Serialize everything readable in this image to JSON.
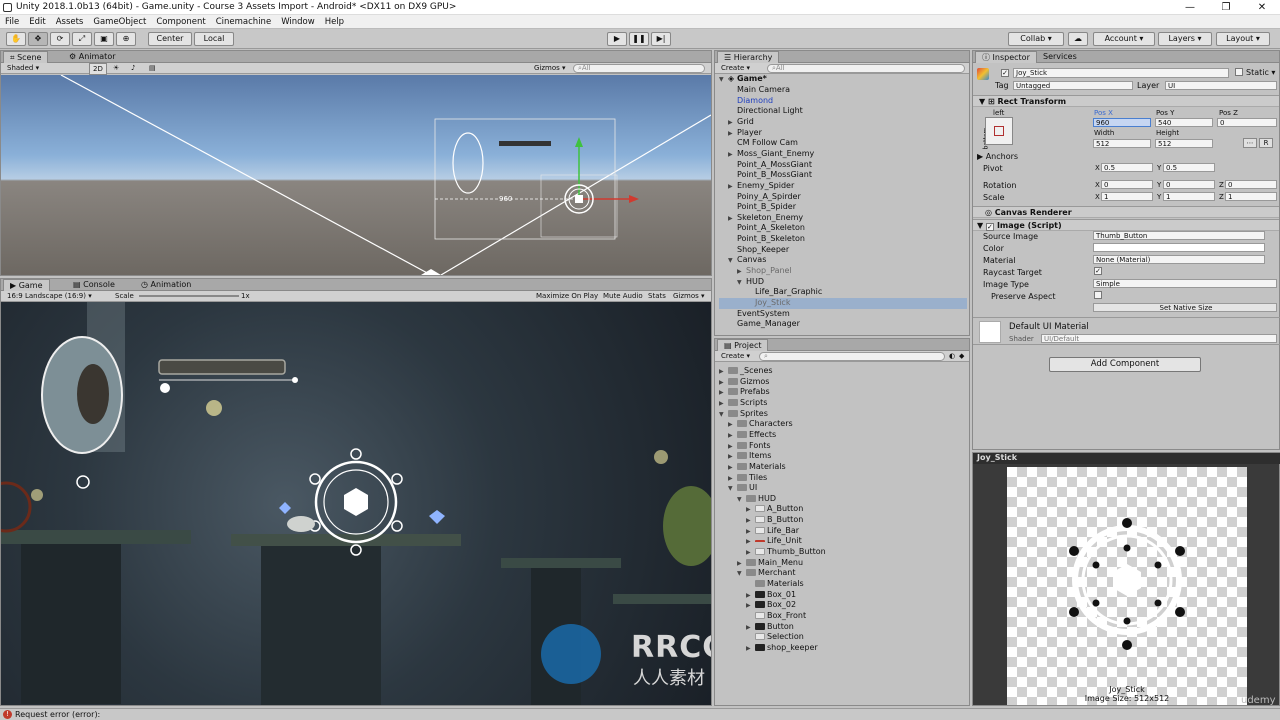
{
  "window": {
    "title": "Unity 2018.1.0b13 (64bit) - Game.unity - Course 3 Assets Import - Android* <DX11 on DX9 GPU>",
    "controls": [
      "—",
      "❐",
      "✕"
    ]
  },
  "menu": [
    "File",
    "Edit",
    "Assets",
    "GameObject",
    "Component",
    "Cinemachine",
    "Window",
    "Help"
  ],
  "toolbar": {
    "pivot": "Center",
    "space": "Local",
    "collab": "Collab",
    "account": "Account",
    "layers": "Layers",
    "layout": "Layout"
  },
  "scene": {
    "tabs": [
      "Scene",
      "Animator"
    ],
    "shading": "Shaded",
    "mode2d": "2D",
    "gizmos": "Gizmos",
    "search": "All",
    "pos_readout": "960"
  },
  "game": {
    "tabs": [
      "Game",
      "Console",
      "Animation"
    ],
    "aspect": "16:9 Landscape (16:9)",
    "scale_label": "Scale",
    "scale_value": "1x",
    "maximize": "Maximize On Play",
    "mute": "Mute Audio",
    "stats": "Stats",
    "gizmos": "Gizmos"
  },
  "hierarchy": {
    "tab": "Hierarchy",
    "create": "Create",
    "search": "All",
    "scene": "Game*",
    "items": [
      {
        "label": "Main Camera",
        "depth": 1,
        "arrow": ""
      },
      {
        "label": "Diamond",
        "depth": 1,
        "arrow": "",
        "color": "#1f3fbf"
      },
      {
        "label": "Directional Light",
        "depth": 1,
        "arrow": ""
      },
      {
        "label": "Grid",
        "depth": 1,
        "arrow": "▶"
      },
      {
        "label": "Player",
        "depth": 1,
        "arrow": "▶"
      },
      {
        "label": "CM Follow Cam",
        "depth": 1,
        "arrow": ""
      },
      {
        "label": "Moss_Giant_Enemy",
        "depth": 1,
        "arrow": "▶"
      },
      {
        "label": "Point_A_MossGiant",
        "depth": 1,
        "arrow": ""
      },
      {
        "label": "Point_B_MossGiant",
        "depth": 1,
        "arrow": ""
      },
      {
        "label": "Enemy_Spider",
        "depth": 1,
        "arrow": "▶"
      },
      {
        "label": "Poiny_A_Spirder",
        "depth": 1,
        "arrow": ""
      },
      {
        "label": "Point_B_Spider",
        "depth": 1,
        "arrow": ""
      },
      {
        "label": "Skeleton_Enemy",
        "depth": 1,
        "arrow": "▶"
      },
      {
        "label": "Point_A_Skeleton",
        "depth": 1,
        "arrow": ""
      },
      {
        "label": "Point_B_Skeleton",
        "depth": 1,
        "arrow": ""
      },
      {
        "label": "Shop_Keeper",
        "depth": 1,
        "arrow": ""
      },
      {
        "label": "Canvas",
        "depth": 1,
        "arrow": "▼"
      },
      {
        "label": "Shop_Panel",
        "depth": 2,
        "arrow": "▶",
        "color": "#6a6a6a"
      },
      {
        "label": "HUD",
        "depth": 2,
        "arrow": "▼"
      },
      {
        "label": "Life_Bar_Graphic",
        "depth": 3,
        "arrow": ""
      },
      {
        "label": "Joy_Stick",
        "depth": 3,
        "arrow": "",
        "color": "#6a6a6a",
        "selected": true
      },
      {
        "label": "EventSystem",
        "depth": 1,
        "arrow": ""
      },
      {
        "label": "Game_Manager",
        "depth": 1,
        "arrow": ""
      }
    ]
  },
  "project": {
    "tab": "Project",
    "create": "Create",
    "items": [
      {
        "label": "_Scenes",
        "depth": 0,
        "arrow": "▶",
        "kind": "folder"
      },
      {
        "label": "Gizmos",
        "depth": 0,
        "arrow": "▶",
        "kind": "folder"
      },
      {
        "label": "Prefabs",
        "depth": 0,
        "arrow": "▶",
        "kind": "folder"
      },
      {
        "label": "Scripts",
        "depth": 0,
        "arrow": "▶",
        "kind": "folder"
      },
      {
        "label": "Sprites",
        "depth": 0,
        "arrow": "▼",
        "kind": "folder"
      },
      {
        "label": "Characters",
        "depth": 1,
        "arrow": "▶",
        "kind": "folder"
      },
      {
        "label": "Effects",
        "depth": 1,
        "arrow": "▶",
        "kind": "folder"
      },
      {
        "label": "Fonts",
        "depth": 1,
        "arrow": "▶",
        "kind": "folder"
      },
      {
        "label": "Items",
        "depth": 1,
        "arrow": "▶",
        "kind": "folder"
      },
      {
        "label": "Materials",
        "depth": 1,
        "arrow": "▶",
        "kind": "folder"
      },
      {
        "label": "Tiles",
        "depth": 1,
        "arrow": "▶",
        "kind": "folder"
      },
      {
        "label": "UI",
        "depth": 1,
        "arrow": "▼",
        "kind": "folder"
      },
      {
        "label": "HUD",
        "depth": 2,
        "arrow": "▼",
        "kind": "folder"
      },
      {
        "label": "A_Button",
        "depth": 3,
        "arrow": "▶",
        "kind": "sprite"
      },
      {
        "label": "B_Button",
        "depth": 3,
        "arrow": "▶",
        "kind": "sprite"
      },
      {
        "label": "Life_Bar",
        "depth": 3,
        "arrow": "▶",
        "kind": "sprite"
      },
      {
        "label": "Life_Unit",
        "depth": 3,
        "arrow": "▶",
        "kind": "red"
      },
      {
        "label": "Thumb_Button",
        "depth": 3,
        "arrow": "▶",
        "kind": "sprite"
      },
      {
        "label": "Main_Menu",
        "depth": 2,
        "arrow": "▶",
        "kind": "folder"
      },
      {
        "label": "Merchant",
        "depth": 2,
        "arrow": "▼",
        "kind": "folder"
      },
      {
        "label": "Materials",
        "depth": 3,
        "arrow": "",
        "kind": "folder"
      },
      {
        "label": "Box_01",
        "depth": 3,
        "arrow": "▶",
        "kind": "dark"
      },
      {
        "label": "Box_02",
        "depth": 3,
        "arrow": "▶",
        "kind": "dark"
      },
      {
        "label": "Box_Front",
        "depth": 3,
        "arrow": "",
        "kind": "sprite"
      },
      {
        "label": "Button",
        "depth": 3,
        "arrow": "▶",
        "kind": "dark"
      },
      {
        "label": "Selection",
        "depth": 3,
        "arrow": "",
        "kind": "sprite"
      },
      {
        "label": "shop_keeper",
        "depth": 3,
        "arrow": "▶",
        "kind": "dark"
      }
    ]
  },
  "inspector": {
    "tabs": [
      "Inspector",
      "Services"
    ],
    "object_name": "Joy_Stick",
    "static": "Static",
    "tag_label": "Tag",
    "tag_value": "Untagged",
    "layer_label": "Layer",
    "layer_value": "UI",
    "rect": {
      "title": "Rect Transform",
      "anchor_h": "left",
      "anchor_v": "bottom",
      "posx_label": "Pos X",
      "posy_label": "Pos Y",
      "posz_label": "Pos Z",
      "posx": "960",
      "posy": "540",
      "posz": "0",
      "width_label": "Width",
      "height_label": "Height",
      "width": "512",
      "height": "512",
      "r_button": "R",
      "anchors": "Anchors",
      "pivot": "Pivot",
      "pivot_x": "0.5",
      "pivot_y": "0.5",
      "rotation": "Rotation",
      "rot_x": "0",
      "rot_y": "0",
      "rot_z": "0",
      "scale": "Scale",
      "scale_x": "1",
      "scale_y": "1",
      "scale_z": "1"
    },
    "canvas_renderer": "Canvas Renderer",
    "image": {
      "title": "Image (Script)",
      "source_label": "Source Image",
      "source_value": "Thumb_Button",
      "color_label": "Color",
      "material_label": "Material",
      "material_value": "None (Material)",
      "raycast_label": "Raycast Target",
      "type_label": "Image Type",
      "type_value": "Simple",
      "preserve_label": "Preserve Aspect",
      "native_button": "Set Native Size"
    },
    "material_name": "Default UI Material",
    "shader_label": "Shader",
    "shader_value": "UI/Default",
    "add_component": "Add Component"
  },
  "preview": {
    "title": "Joy_Stick",
    "caption_name": "Joy_Stick",
    "caption_size": "Image Size: 512x512"
  },
  "status": {
    "message": "Request error (error):"
  },
  "watermark": {
    "brand": "RRCG",
    "sub": "人人素材",
    "udemy": "udemy"
  },
  "colors": {
    "selection": "#3d6fb6",
    "hierarchy_selected": "#9ab0cc",
    "field_highlight": "#4a7fd0",
    "error": "#c0392b",
    "panel_bg": "#c2c2c2"
  }
}
